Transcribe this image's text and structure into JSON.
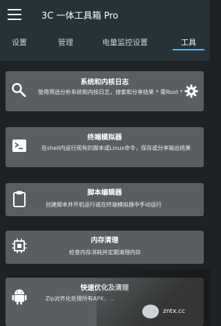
{
  "app": {
    "title": "3C 一体工具箱 Pro"
  },
  "tabs": [
    {
      "label": "设置"
    },
    {
      "label": "管理"
    },
    {
      "label": "电量监控设置"
    },
    {
      "label": "工具"
    }
  ],
  "cards": [
    {
      "title": "系统和内核日志",
      "desc": "使用筛选分析系统和内核日志，搜索和分享结果 * 需Root *",
      "icon": "search-icon",
      "action_icon": "gear-icon"
    },
    {
      "title": "终端模拟器",
      "desc": "在shell内运行现有的脚本或Linux命令，保存或分享输出结果",
      "icon": "terminal-icon"
    },
    {
      "title": "脚本编辑器",
      "desc": "创建脚本并开机运行或在终端模拟器中手动运行",
      "icon": "clipboard-icon"
    },
    {
      "title": "内存清理",
      "desc": "检查内存消耗并定期清理内存",
      "icon": "memory-chip-icon"
    },
    {
      "title": "快速优化及清理",
      "desc": "Zip对齐化处理所有APK，...",
      "icon": "android-icon"
    }
  ],
  "watermark": {
    "text": "zntx.cc"
  }
}
